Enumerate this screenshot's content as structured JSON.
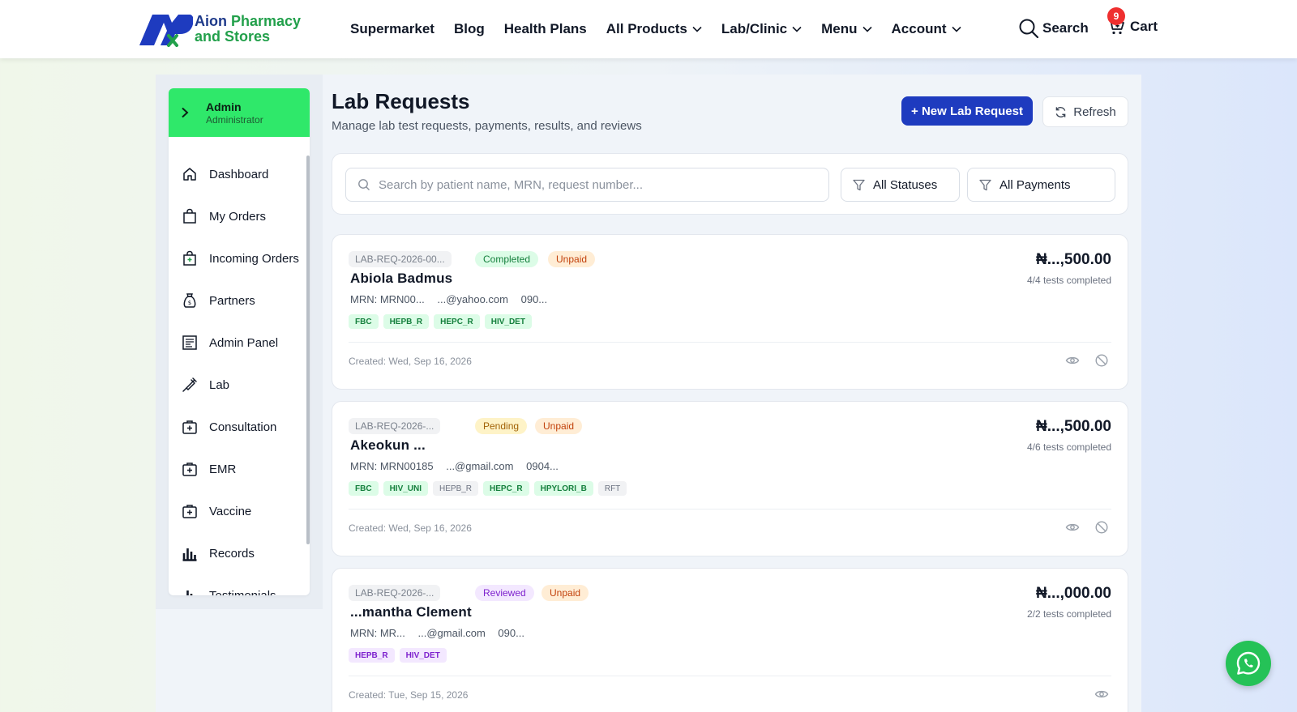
{
  "brand": {
    "line1a": "Aion",
    "line1b": "Pharmacy",
    "line2": "and Stores"
  },
  "nav": {
    "items": [
      "Supermarket",
      "Blog",
      "Health Plans",
      "All Products",
      "Lab/Clinic",
      "Menu",
      "Account"
    ],
    "search_label": "Search",
    "cart_label": "Cart",
    "cart_count": "9"
  },
  "sidebar": {
    "user_name": "Admin",
    "user_role": "Administrator",
    "items": [
      "Dashboard",
      "My Orders",
      "Incoming Orders",
      "Partners",
      "Admin Panel",
      "Lab",
      "Consultation",
      "EMR",
      "Vaccine",
      "Records",
      "Testimonials"
    ]
  },
  "page": {
    "title": "Lab Requests",
    "subtitle": "Manage lab test requests, payments, results, and reviews",
    "new_button": "+ New Lab Request",
    "refresh_button": "Refresh"
  },
  "filters": {
    "search_placeholder": "Search by patient name, MRN, request number...",
    "status": "All Statuses",
    "payment": "All Payments"
  },
  "requests": [
    {
      "number": "LAB-REQ-2026-00...",
      "status": "Completed",
      "payment": "Unpaid",
      "patient": "Abiola Badmus",
      "mrn": "MRN: MRN00...",
      "email": "...@yahoo.com",
      "phone": "090...",
      "tests": [
        "FBC",
        "HEPB_R",
        "HEPC_R",
        "HIV_DET"
      ],
      "amount": "₦...,500.00",
      "progress": "4/4 tests completed",
      "created": "Created: Wed, Sep 16, 2026"
    },
    {
      "number": "LAB-REQ-2026-...",
      "status": "Pending",
      "payment": "Unpaid",
      "patient": "Akeokun ...",
      "mrn": "MRN: MRN00185",
      "email": "...@gmail.com",
      "phone": "0904...",
      "tests": [
        "FBC",
        "HIV_UNI",
        "HEPB_R",
        "HEPC_R",
        "HPYLORI_B",
        "RFT"
      ],
      "amount": "₦...,500.00",
      "progress": "4/6 tests completed",
      "created": "Created: Wed, Sep 16, 2026"
    },
    {
      "number": "LAB-REQ-2026-...",
      "status": "Reviewed",
      "payment": "Unpaid",
      "patient": "...mantha Clement",
      "mrn": "MRN: MR...",
      "email": "...@gmail.com",
      "phone": "090...",
      "tests": [
        "HEPB_R",
        "HIV_DET"
      ],
      "amount": "₦...,000.00",
      "progress": "2/2 tests completed",
      "created": "Created: Tue, Sep 15, 2026"
    }
  ],
  "colors": {
    "primary": "#1e3bbf",
    "admin": "#2fe86a",
    "whatsapp": "#25c257"
  },
  "icons": {
    "whatsapp": "whatsapp-icon"
  }
}
